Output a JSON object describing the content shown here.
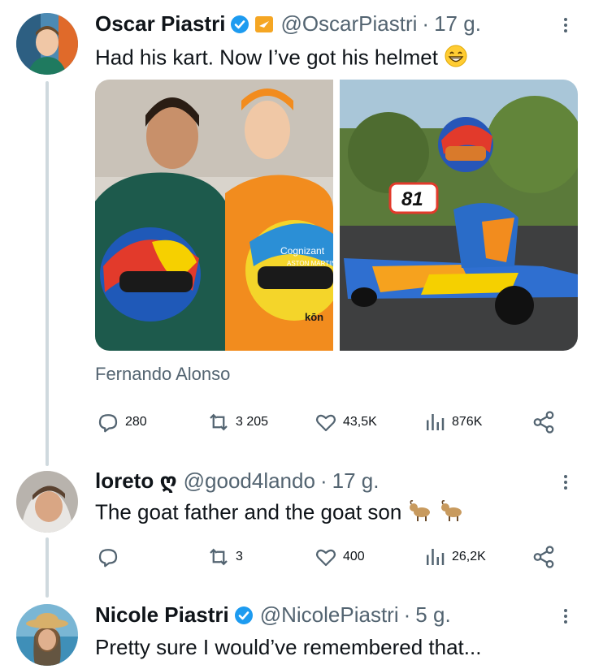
{
  "tweets": [
    {
      "name": "Oscar Piastri",
      "handle": "@OscarPiastri",
      "time": "17 g.",
      "text": "Had his kart. Now I’ve got his helmet",
      "tag": "Fernando Alonso",
      "stats": {
        "replies": "280",
        "reposts": "3 205",
        "likes": "43,5K",
        "views": "876K"
      }
    },
    {
      "name": "loreto ღ",
      "handle": "@good4lando",
      "time": "17 g.",
      "text": "The goat father and the goat son",
      "stats": {
        "replies": "",
        "reposts": "3",
        "likes": "400",
        "views": "26,2K"
      }
    },
    {
      "name": "Nicole Piastri",
      "handle": "@NicolePiastri",
      "time": "5 g.",
      "text": "Pretty sure I would’ve remembered that..."
    }
  ],
  "media": {
    "left": {
      "kart_number": "",
      "helmet_text_1": "Cognizant",
      "helmet_text_2": "ASTON MARTIN",
      "helmet_text_3": "kōn"
    },
    "right": {
      "kart_number": "81"
    }
  },
  "icons": [
    "verified-badge-icon",
    "affiliate-badge-icon",
    "more-icon",
    "reply-icon",
    "repost-icon",
    "like-icon",
    "views-icon",
    "share-icon",
    "grin-emoji-icon",
    "goat-emoji-icon"
  ],
  "colors": {
    "verified": "#1d9bf0",
    "affiliate": "#f5a623",
    "thread_line": "#cfd9de",
    "muted": "#536471"
  }
}
